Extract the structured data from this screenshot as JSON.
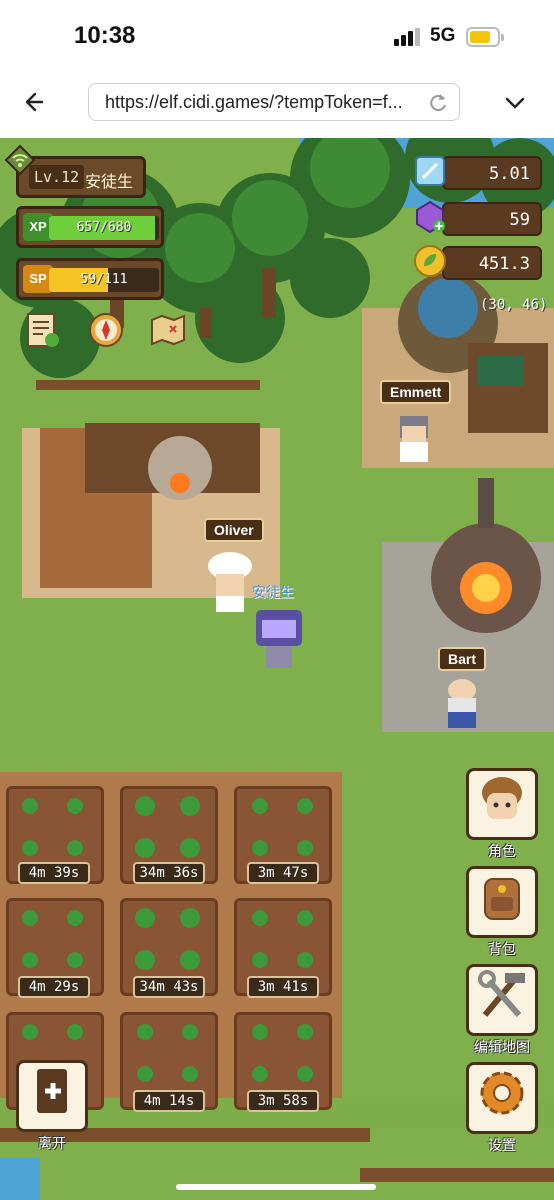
{
  "status_bar": {
    "time": "10:38",
    "network": "5G",
    "battery_level": 0.75
  },
  "browser": {
    "url": "https://elf.cidi.games/?tempToken=f..."
  },
  "hud": {
    "level_label": "Lv.12",
    "player_name": "安徒生",
    "xp": {
      "badge": "XP",
      "text": "657/680",
      "fraction": 0.966,
      "color": "#6fcf3a"
    },
    "sp": {
      "badge": "SP",
      "text": "59/111",
      "fraction": 0.532,
      "color": "#f5c422"
    }
  },
  "resources": {
    "crystal": {
      "value": "5.01",
      "icon": "ice-crystal-icon"
    },
    "gem": {
      "value": "59",
      "icon": "purple-gem-icon"
    },
    "coin": {
      "value": "451.3",
      "icon": "leaf-coin-icon"
    }
  },
  "coords": "(30, 46)",
  "quick_icons": [
    "quest-scroll-icon",
    "compass-icon",
    "treasure-map-icon"
  ],
  "npcs": [
    {
      "name": "Emmett"
    },
    {
      "name": "Oliver"
    },
    {
      "name": "Bart"
    }
  ],
  "player_label": "安徒生",
  "farm": {
    "timers": [
      "4m 39s",
      "34m 36s",
      "3m 47s",
      "4m 29s",
      "34m 43s",
      "3m 41s",
      "4m 14s",
      "3m 58s"
    ]
  },
  "side_menu": {
    "character": "角色",
    "backpack": "背包",
    "edit_map": "编辑地图",
    "settings": "设置"
  },
  "leave_label": "离开"
}
